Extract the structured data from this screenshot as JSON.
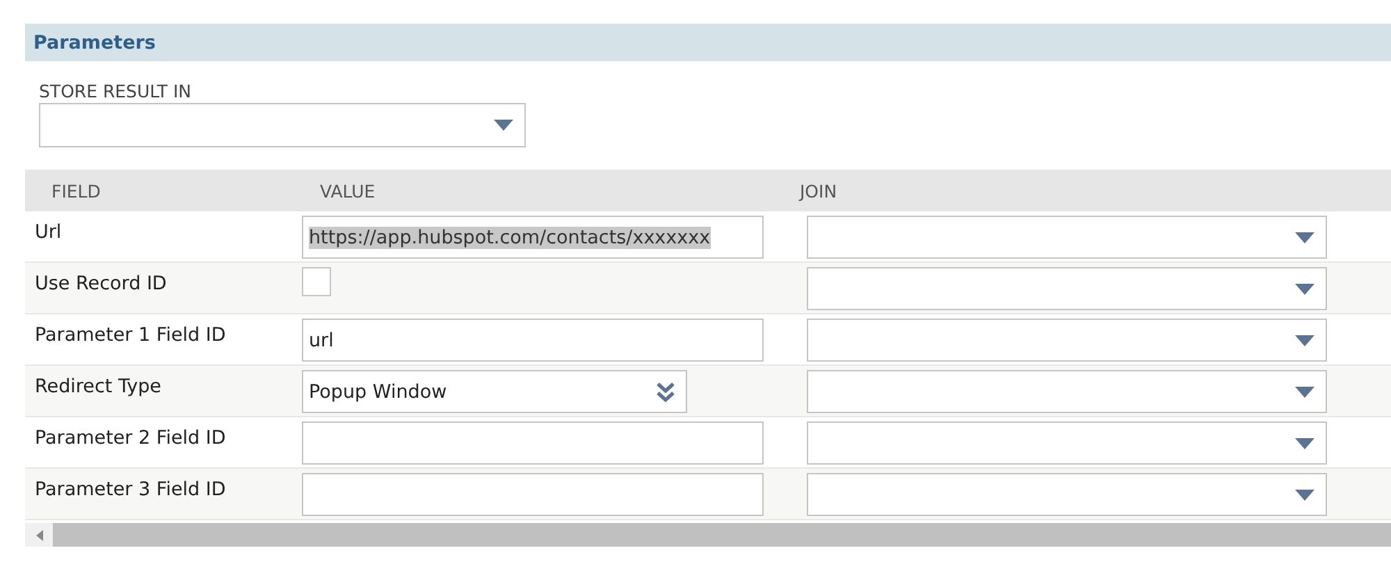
{
  "section": {
    "title": "Parameters"
  },
  "store_result": {
    "label": "STORE RESULT IN"
  },
  "table": {
    "columns": [
      "FIELD",
      "VALUE",
      "JOIN"
    ],
    "rows": [
      {
        "field": "Url",
        "kind": "text",
        "value": "https://app.hubspot.com/contacts/xxxxxxx",
        "highlighted": true
      },
      {
        "field": "Use Record ID",
        "kind": "checkbox",
        "checked": false
      },
      {
        "field": "Parameter 1 Field ID",
        "kind": "text",
        "value": "url",
        "highlighted": false
      },
      {
        "field": "Redirect Type",
        "kind": "select",
        "value": "Popup Window"
      },
      {
        "field": "Parameter 2 Field ID",
        "kind": "text"
      },
      {
        "field": "Parameter 3 Field ID",
        "kind": "text"
      }
    ]
  }
}
